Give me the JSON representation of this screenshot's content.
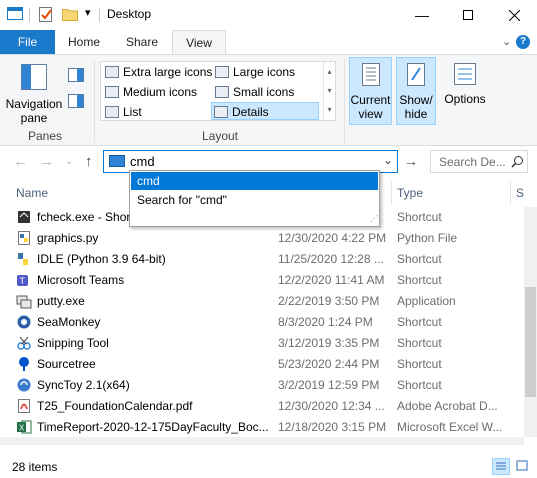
{
  "window": {
    "title": "Desktop"
  },
  "tabs": [
    {
      "label": "File"
    },
    {
      "label": "Home"
    },
    {
      "label": "Share"
    },
    {
      "label": "View"
    }
  ],
  "ribbon": {
    "navigation_pane": "Navigation pane",
    "panes_group": "Panes",
    "layout_group": "Layout",
    "layout_items": {
      "extra_large": "Extra large icons",
      "large": "Large icons",
      "medium": "Medium icons",
      "small": "Small icons",
      "list": "List",
      "details": "Details"
    },
    "current_view": "Current view",
    "show_hide": "Show/ hide",
    "options": "Options"
  },
  "address": {
    "value": "cmd",
    "search_placeholder": "Search De..."
  },
  "dropdown": {
    "items": [
      {
        "label": "cmd"
      },
      {
        "label": "Search for \"cmd\""
      }
    ]
  },
  "columns": {
    "name": "Name",
    "type": "Type",
    "size_partial": "S"
  },
  "files": [
    {
      "name": "fcheck.exe - Short",
      "date": "",
      "type": "Shortcut",
      "icon": "shortcut-app-icon"
    },
    {
      "name": "graphics.py",
      "date": "12/30/2020 4:22 PM",
      "type": "Python File",
      "icon": "python-file-icon"
    },
    {
      "name": "IDLE (Python 3.9 64-bit)",
      "date": "11/25/2020 12:28 ...",
      "type": "Shortcut",
      "icon": "idle-icon"
    },
    {
      "name": "Microsoft Teams",
      "date": "12/2/2020 11:41 AM",
      "type": "Shortcut",
      "icon": "teams-icon"
    },
    {
      "name": "putty.exe",
      "date": "2/22/2019 3:50 PM",
      "type": "Application",
      "icon": "putty-icon"
    },
    {
      "name": "SeaMonkey",
      "date": "8/3/2020 1:24 PM",
      "type": "Shortcut",
      "icon": "seamonkey-icon"
    },
    {
      "name": "Snipping Tool",
      "date": "3/12/2019 3:35 PM",
      "type": "Shortcut",
      "icon": "snipping-tool-icon"
    },
    {
      "name": "Sourcetree",
      "date": "5/23/2020 2:44 PM",
      "type": "Shortcut",
      "icon": "sourcetree-icon"
    },
    {
      "name": "SyncToy 2.1(x64)",
      "date": "3/2/2019 12:59 PM",
      "type": "Shortcut",
      "icon": "synctoy-icon"
    },
    {
      "name": "T25_FoundationCalendar.pdf",
      "date": "12/30/2020 12:34 ...",
      "type": "Adobe Acrobat D...",
      "icon": "pdf-icon"
    },
    {
      "name": "TimeReport-2020-12-175DayFaculty_Boc...",
      "date": "12/18/2020 3:15 PM",
      "type": "Microsoft Excel W...",
      "icon": "excel-icon"
    }
  ],
  "status": {
    "item_count": "28 items"
  },
  "colors": {
    "accent": "#0078d7",
    "file_tab": "#1979ca",
    "selected": "#cce8ff"
  }
}
